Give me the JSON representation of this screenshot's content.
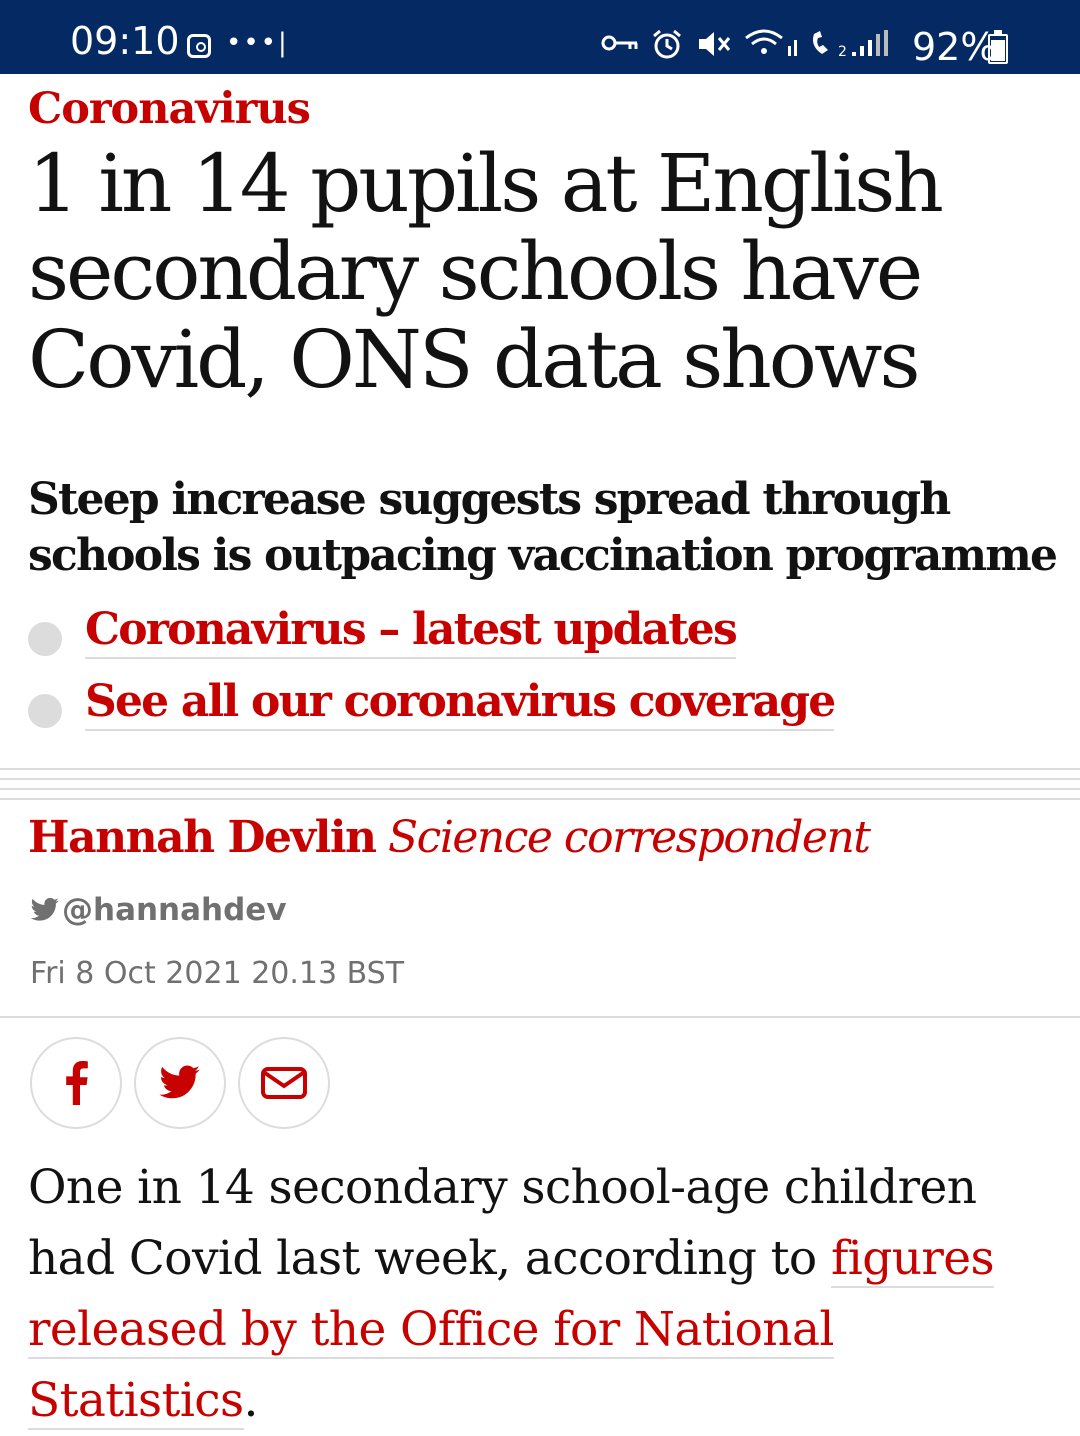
{
  "status_bar": {
    "time": "09:10",
    "battery": "92%",
    "background": "#052962"
  },
  "article": {
    "kicker": "Coronavirus",
    "headline": "1 in 14 pupils at English secondary schools have Covid, ONS data shows",
    "standfirst": "Steep increase suggests spread through schools is outpacing vaccination programme",
    "related_links": [
      "Coronavirus – latest updates",
      "See all our coronavirus coverage"
    ],
    "byline": {
      "author": "Hannah Devlin",
      "role": "Science correspondent",
      "twitter": "@hannahdev"
    },
    "date": "Fri 8 Oct 2021 20.13 BST",
    "share_buttons": [
      "facebook-icon",
      "twitter-icon",
      "email-icon"
    ],
    "body": {
      "text_before": "One in 14 secondary school-age children had Covid last week, according to ",
      "link_text": "figures released by the Office for National Statistics",
      "text_after": "."
    }
  },
  "colors": {
    "accent_red": "#c70000",
    "text": "#121212",
    "muted": "#707070",
    "divider": "#dcdcdc"
  }
}
